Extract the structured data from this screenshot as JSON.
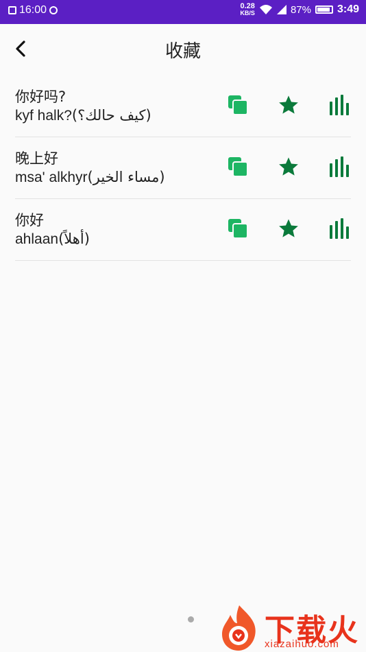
{
  "status_bar": {
    "time": "16:00",
    "net_speed": "0.28",
    "net_unit": "KB/S",
    "battery_pct": "87%",
    "clock_right": "3:49",
    "bg_color": "#5b1fc4"
  },
  "header": {
    "title": "收藏"
  },
  "favorites": [
    {
      "chinese": "你好吗?",
      "latin": "kyf halk?",
      "arabic": "(كيف حالك؟)"
    },
    {
      "chinese": "晚上好",
      "latin": "msa' alkhyr",
      "arabic": "(مساء الخير)"
    },
    {
      "chinese": "你好",
      "latin": "ahlaan",
      "arabic": "(أهلاً)"
    }
  ],
  "icons": {
    "copy": "copy-icon",
    "star": "star-icon",
    "audio": "sound-bars-icon",
    "back": "chevron-left-icon"
  },
  "colors": {
    "copy_green": "#1db563",
    "dark_green": "#0b7a3b"
  },
  "watermark": {
    "text": "下载火",
    "url": "xiazaihuo.com"
  }
}
